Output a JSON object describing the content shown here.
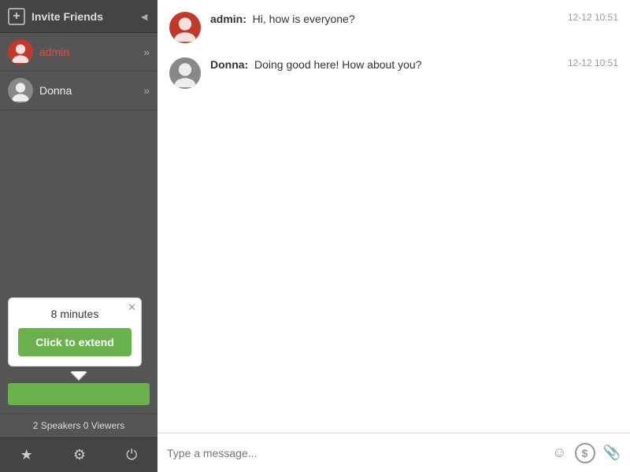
{
  "sidebar": {
    "header": {
      "title": "Invite Friends",
      "add_icon": "+",
      "collapse_icon": "◄"
    },
    "users": [
      {
        "name": "admin",
        "type": "admin"
      },
      {
        "name": "Donna",
        "type": "default"
      }
    ],
    "tooltip": {
      "minutes": "8 minutes",
      "close_icon": "✕",
      "extend_label": "Click to extend",
      "arrow_tip": ""
    },
    "green_bar": "",
    "speakers_bar": "2 Speakers  0 Viewers",
    "toolbar_icons": [
      "★",
      "⚙",
      "⏻"
    ]
  },
  "chat": {
    "messages": [
      {
        "sender": "admin",
        "text": "Hi, how is everyone?",
        "timestamp": "12-12 10:51",
        "type": "admin"
      },
      {
        "sender": "Donna",
        "text": "Doing good here! How about you?",
        "timestamp": "12-12 10:51",
        "type": "default"
      }
    ],
    "input_placeholder": "Type a message...",
    "icons": {
      "emoji": "☺",
      "dollar": "$",
      "attach": "🖇"
    }
  }
}
